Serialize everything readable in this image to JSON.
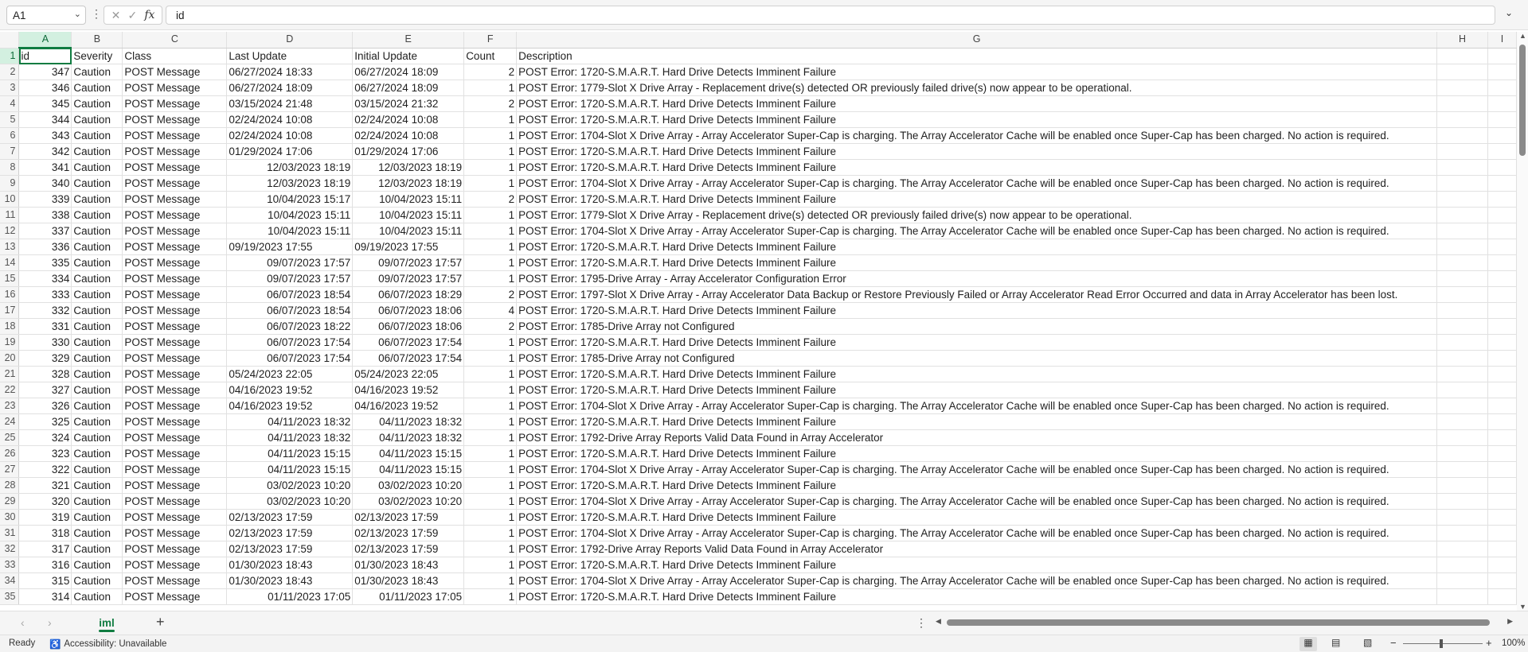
{
  "formula_bar": {
    "name_box": "A1",
    "formula": "id"
  },
  "columns": [
    {
      "letter": "A",
      "header": "id"
    },
    {
      "letter": "B",
      "header": "Severity"
    },
    {
      "letter": "C",
      "header": "Class"
    },
    {
      "letter": "D",
      "header": "Last Update"
    },
    {
      "letter": "E",
      "header": "Initial Update"
    },
    {
      "letter": "F",
      "header": "Count"
    },
    {
      "letter": "G",
      "header": "Description"
    },
    {
      "letter": "H",
      "header": ""
    },
    {
      "letter": "I",
      "header": ""
    }
  ],
  "rows": [
    {
      "id": "347",
      "severity": "Caution",
      "class": "POST Message",
      "last_update": "06/27/2024 18:33",
      "initial_update": "06/27/2024 18:09",
      "count": "2",
      "description": "POST Error: 1720-S.M.A.R.T. Hard Drive Detects Imminent Failure",
      "date_align": "left"
    },
    {
      "id": "346",
      "severity": "Caution",
      "class": "POST Message",
      "last_update": "06/27/2024 18:09",
      "initial_update": "06/27/2024 18:09",
      "count": "1",
      "description": "POST Error: 1779-Slot X Drive Array - Replacement drive(s) detected OR previously failed drive(s) now appear to be operational.",
      "date_align": "left"
    },
    {
      "id": "345",
      "severity": "Caution",
      "class": "POST Message",
      "last_update": "03/15/2024 21:48",
      "initial_update": "03/15/2024 21:32",
      "count": "2",
      "description": "POST Error: 1720-S.M.A.R.T. Hard Drive Detects Imminent Failure",
      "date_align": "left"
    },
    {
      "id": "344",
      "severity": "Caution",
      "class": "POST Message",
      "last_update": "02/24/2024 10:08",
      "initial_update": "02/24/2024 10:08",
      "count": "1",
      "description": "POST Error: 1720-S.M.A.R.T. Hard Drive Detects Imminent Failure",
      "date_align": "left"
    },
    {
      "id": "343",
      "severity": "Caution",
      "class": "POST Message",
      "last_update": "02/24/2024 10:08",
      "initial_update": "02/24/2024 10:08",
      "count": "1",
      "description": "POST Error: 1704-Slot X Drive Array - Array Accelerator Super-Cap is charging. The Array Accelerator Cache will be enabled once Super-Cap has been charged. No action is required.",
      "date_align": "left"
    },
    {
      "id": "342",
      "severity": "Caution",
      "class": "POST Message",
      "last_update": "01/29/2024 17:06",
      "initial_update": "01/29/2024 17:06",
      "count": "1",
      "description": "POST Error: 1720-S.M.A.R.T. Hard Drive Detects Imminent Failure",
      "date_align": "left"
    },
    {
      "id": "341",
      "severity": "Caution",
      "class": "POST Message",
      "last_update": "12/03/2023 18:19",
      "initial_update": "12/03/2023 18:19",
      "count": "1",
      "description": "POST Error: 1720-S.M.A.R.T. Hard Drive Detects Imminent Failure",
      "date_align": "right"
    },
    {
      "id": "340",
      "severity": "Caution",
      "class": "POST Message",
      "last_update": "12/03/2023 18:19",
      "initial_update": "12/03/2023 18:19",
      "count": "1",
      "description": "POST Error: 1704-Slot X Drive Array - Array Accelerator Super-Cap is charging. The Array Accelerator Cache will be enabled once Super-Cap has been charged. No action is required.",
      "date_align": "right"
    },
    {
      "id": "339",
      "severity": "Caution",
      "class": "POST Message",
      "last_update": "10/04/2023 15:17",
      "initial_update": "10/04/2023 15:11",
      "count": "2",
      "description": "POST Error: 1720-S.M.A.R.T. Hard Drive Detects Imminent Failure",
      "date_align": "right"
    },
    {
      "id": "338",
      "severity": "Caution",
      "class": "POST Message",
      "last_update": "10/04/2023 15:11",
      "initial_update": "10/04/2023 15:11",
      "count": "1",
      "description": "POST Error: 1779-Slot X Drive Array - Replacement drive(s) detected OR previously failed drive(s) now appear to be operational.",
      "date_align": "right"
    },
    {
      "id": "337",
      "severity": "Caution",
      "class": "POST Message",
      "last_update": "10/04/2023 15:11",
      "initial_update": "10/04/2023 15:11",
      "count": "1",
      "description": "POST Error: 1704-Slot X Drive Array - Array Accelerator Super-Cap is charging. The Array Accelerator Cache will be enabled once Super-Cap has been charged. No action is required.",
      "date_align": "right"
    },
    {
      "id": "336",
      "severity": "Caution",
      "class": "POST Message",
      "last_update": "09/19/2023 17:55",
      "initial_update": "09/19/2023 17:55",
      "count": "1",
      "description": "POST Error: 1720-S.M.A.R.T. Hard Drive Detects Imminent Failure",
      "date_align": "left"
    },
    {
      "id": "335",
      "severity": "Caution",
      "class": "POST Message",
      "last_update": "09/07/2023 17:57",
      "initial_update": "09/07/2023 17:57",
      "count": "1",
      "description": "POST Error: 1720-S.M.A.R.T. Hard Drive Detects Imminent Failure",
      "date_align": "right"
    },
    {
      "id": "334",
      "severity": "Caution",
      "class": "POST Message",
      "last_update": "09/07/2023 17:57",
      "initial_update": "09/07/2023 17:57",
      "count": "1",
      "description": "POST Error: 1795-Drive Array - Array Accelerator Configuration Error",
      "date_align": "right"
    },
    {
      "id": "333",
      "severity": "Caution",
      "class": "POST Message",
      "last_update": "06/07/2023 18:54",
      "initial_update": "06/07/2023 18:29",
      "count": "2",
      "description": "POST Error: 1797-Slot X Drive Array - Array Accelerator Data Backup or Restore Previously Failed or Array Accelerator Read Error Occurred and data in Array Accelerator has been lost.",
      "date_align": "right"
    },
    {
      "id": "332",
      "severity": "Caution",
      "class": "POST Message",
      "last_update": "06/07/2023 18:54",
      "initial_update": "06/07/2023 18:06",
      "count": "4",
      "description": "POST Error: 1720-S.M.A.R.T. Hard Drive Detects Imminent Failure",
      "date_align": "right"
    },
    {
      "id": "331",
      "severity": "Caution",
      "class": "POST Message",
      "last_update": "06/07/2023 18:22",
      "initial_update": "06/07/2023 18:06",
      "count": "2",
      "description": "POST Error: 1785-Drive Array not Configured",
      "date_align": "right"
    },
    {
      "id": "330",
      "severity": "Caution",
      "class": "POST Message",
      "last_update": "06/07/2023 17:54",
      "initial_update": "06/07/2023 17:54",
      "count": "1",
      "description": "POST Error: 1720-S.M.A.R.T. Hard Drive Detects Imminent Failure",
      "date_align": "right"
    },
    {
      "id": "329",
      "severity": "Caution",
      "class": "POST Message",
      "last_update": "06/07/2023 17:54",
      "initial_update": "06/07/2023 17:54",
      "count": "1",
      "description": "POST Error: 1785-Drive Array not Configured",
      "date_align": "right"
    },
    {
      "id": "328",
      "severity": "Caution",
      "class": "POST Message",
      "last_update": "05/24/2023 22:05",
      "initial_update": "05/24/2023 22:05",
      "count": "1",
      "description": "POST Error: 1720-S.M.A.R.T. Hard Drive Detects Imminent Failure",
      "date_align": "left"
    },
    {
      "id": "327",
      "severity": "Caution",
      "class": "POST Message",
      "last_update": "04/16/2023 19:52",
      "initial_update": "04/16/2023 19:52",
      "count": "1",
      "description": "POST Error: 1720-S.M.A.R.T. Hard Drive Detects Imminent Failure",
      "date_align": "left"
    },
    {
      "id": "326",
      "severity": "Caution",
      "class": "POST Message",
      "last_update": "04/16/2023 19:52",
      "initial_update": "04/16/2023 19:52",
      "count": "1",
      "description": "POST Error: 1704-Slot X Drive Array - Array Accelerator Super-Cap is charging. The Array Accelerator Cache will be enabled once Super-Cap has been charged. No action is required.",
      "date_align": "left"
    },
    {
      "id": "325",
      "severity": "Caution",
      "class": "POST Message",
      "last_update": "04/11/2023 18:32",
      "initial_update": "04/11/2023 18:32",
      "count": "1",
      "description": "POST Error: 1720-S.M.A.R.T. Hard Drive Detects Imminent Failure",
      "date_align": "right"
    },
    {
      "id": "324",
      "severity": "Caution",
      "class": "POST Message",
      "last_update": "04/11/2023 18:32",
      "initial_update": "04/11/2023 18:32",
      "count": "1",
      "description": "POST Error: 1792-Drive Array Reports Valid Data Found in Array Accelerator",
      "date_align": "right"
    },
    {
      "id": "323",
      "severity": "Caution",
      "class": "POST Message",
      "last_update": "04/11/2023 15:15",
      "initial_update": "04/11/2023 15:15",
      "count": "1",
      "description": "POST Error: 1720-S.M.A.R.T. Hard Drive Detects Imminent Failure",
      "date_align": "right"
    },
    {
      "id": "322",
      "severity": "Caution",
      "class": "POST Message",
      "last_update": "04/11/2023 15:15",
      "initial_update": "04/11/2023 15:15",
      "count": "1",
      "description": "POST Error: 1704-Slot X Drive Array - Array Accelerator Super-Cap is charging. The Array Accelerator Cache will be enabled once Super-Cap has been charged. No action is required.",
      "date_align": "right"
    },
    {
      "id": "321",
      "severity": "Caution",
      "class": "POST Message",
      "last_update": "03/02/2023 10:20",
      "initial_update": "03/02/2023 10:20",
      "count": "1",
      "description": "POST Error: 1720-S.M.A.R.T. Hard Drive Detects Imminent Failure",
      "date_align": "right"
    },
    {
      "id": "320",
      "severity": "Caution",
      "class": "POST Message",
      "last_update": "03/02/2023 10:20",
      "initial_update": "03/02/2023 10:20",
      "count": "1",
      "description": "POST Error: 1704-Slot X Drive Array - Array Accelerator Super-Cap is charging. The Array Accelerator Cache will be enabled once Super-Cap has been charged. No action is required.",
      "date_align": "right"
    },
    {
      "id": "319",
      "severity": "Caution",
      "class": "POST Message",
      "last_update": "02/13/2023 17:59",
      "initial_update": "02/13/2023 17:59",
      "count": "1",
      "description": "POST Error: 1720-S.M.A.R.T. Hard Drive Detects Imminent Failure",
      "date_align": "left"
    },
    {
      "id": "318",
      "severity": "Caution",
      "class": "POST Message",
      "last_update": "02/13/2023 17:59",
      "initial_update": "02/13/2023 17:59",
      "count": "1",
      "description": "POST Error: 1704-Slot X Drive Array - Array Accelerator Super-Cap is charging. The Array Accelerator Cache will be enabled once Super-Cap has been charged. No action is required.",
      "date_align": "left"
    },
    {
      "id": "317",
      "severity": "Caution",
      "class": "POST Message",
      "last_update": "02/13/2023 17:59",
      "initial_update": "02/13/2023 17:59",
      "count": "1",
      "description": "POST Error: 1792-Drive Array Reports Valid Data Found in Array Accelerator",
      "date_align": "left"
    },
    {
      "id": "316",
      "severity": "Caution",
      "class": "POST Message",
      "last_update": "01/30/2023 18:43",
      "initial_update": "01/30/2023 18:43",
      "count": "1",
      "description": "POST Error: 1720-S.M.A.R.T. Hard Drive Detects Imminent Failure",
      "date_align": "left"
    },
    {
      "id": "315",
      "severity": "Caution",
      "class": "POST Message",
      "last_update": "01/30/2023 18:43",
      "initial_update": "01/30/2023 18:43",
      "count": "1",
      "description": "POST Error: 1704-Slot X Drive Array - Array Accelerator Super-Cap is charging. The Array Accelerator Cache will be enabled once Super-Cap has been charged. No action is required.",
      "date_align": "left"
    },
    {
      "id": "314",
      "severity": "Caution",
      "class": "POST Message",
      "last_update": "01/11/2023 17:05",
      "initial_update": "01/11/2023 17:05",
      "count": "1",
      "description": "POST Error: 1720-S.M.A.R.T. Hard Drive Detects Imminent Failure",
      "date_align": "right"
    }
  ],
  "sheet_tabs": [
    {
      "label": "iml",
      "active": true
    }
  ],
  "status_bar": {
    "ready": "Ready",
    "accessibility": "Accessibility: Unavailable",
    "zoom": "100%"
  },
  "colors": {
    "accent": "#107c41",
    "header_bg": "#f5f5f5"
  },
  "icons": {
    "name_box_dropdown": "chevron-down-icon",
    "cancel": "close-icon",
    "enter": "checkmark-icon",
    "function": "fx-icon",
    "expand": "chevron-down-icon",
    "add_sheet": "plus-icon",
    "accessibility": "accessibility-icon"
  }
}
